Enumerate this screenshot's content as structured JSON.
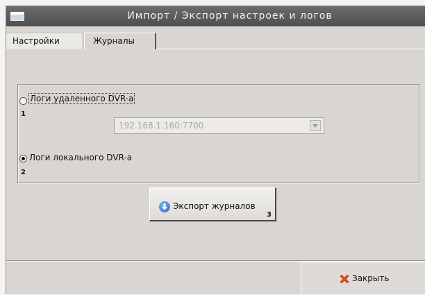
{
  "window": {
    "title": "Импорт / Экспорт настроек и логов"
  },
  "tabs": [
    {
      "label": "Настройки",
      "active": false
    },
    {
      "label": "Журналы",
      "active": true
    }
  ],
  "logs": {
    "remote": {
      "label": "Логи удаленного DVR-а",
      "checked": false,
      "marker": "1"
    },
    "address": {
      "value": "192.168.1.160:7700",
      "disabled": true
    },
    "local": {
      "label": "Логи локального DVR-а",
      "checked": true,
      "marker": "2"
    }
  },
  "export_button": {
    "label": "Экспорт журналов",
    "marker": "3",
    "icon": "download-arrow-icon"
  },
  "close_button": {
    "label": "Закрыть",
    "icon": "red-x-icon"
  },
  "colors": {
    "titlebar": "#555555",
    "window_bg": "#d9d6d2",
    "close_icon": "#e8491d",
    "export_icon": "#2b78d4"
  }
}
